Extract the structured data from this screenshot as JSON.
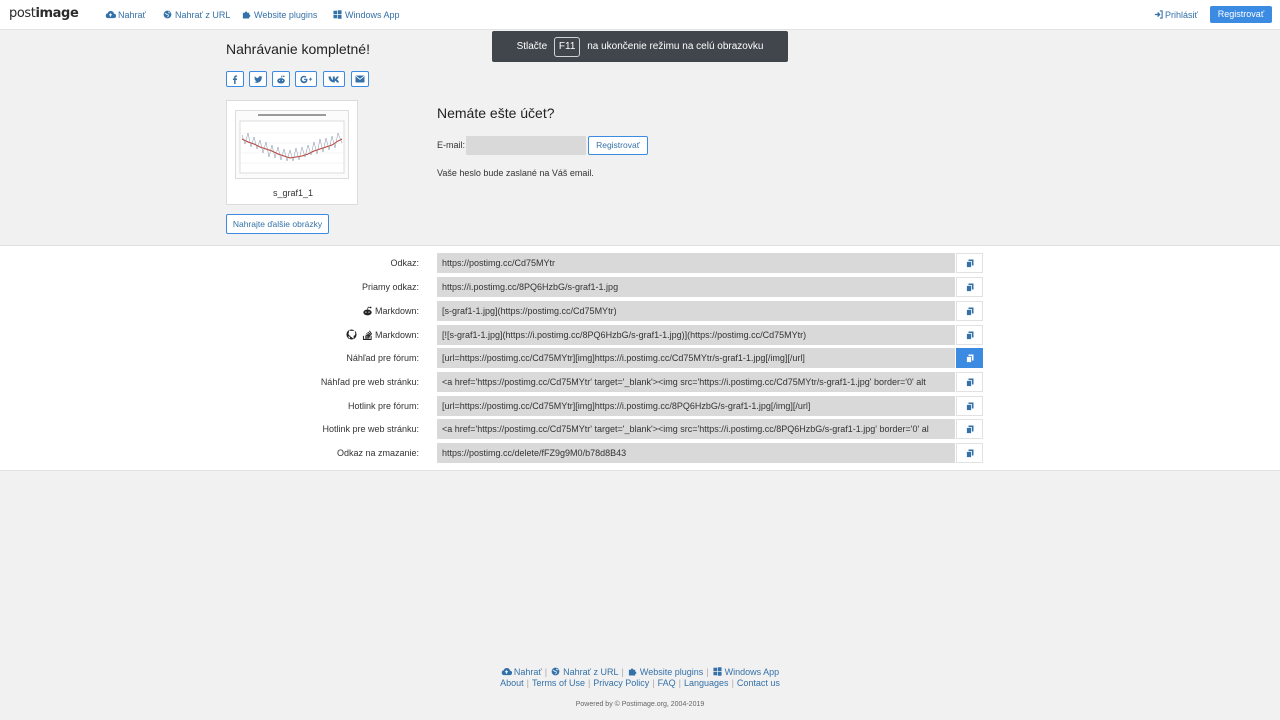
{
  "header": {
    "logo_light": "post",
    "logo_bold": "image",
    "nav": [
      "Nahrať",
      "Nahrať z URL",
      "Website plugins",
      "Windows App"
    ],
    "login": "Prihlásiť",
    "register": "Registrovať"
  },
  "toast": {
    "before": "Stlačte",
    "key": "F11",
    "after": "na ukončenie režimu na celú obrazovku"
  },
  "upload": {
    "title": "Nahrávanie kompletné!",
    "share_icons": [
      "facebook-icon",
      "twitter-icon",
      "reddit-icon",
      "google-plus-icon",
      "vk-icon",
      "email-icon"
    ],
    "image_name": "s_graf1_1",
    "more_button": "Nahrajte ďalšie obrázky"
  },
  "account": {
    "title": "Nemáte ešte účet?",
    "email_label": "E-mail:",
    "email_value": "",
    "register_button": "Registrovať",
    "note": "Vaše heslo bude zaslané na Váš email."
  },
  "links": [
    {
      "label": "Odkaz:",
      "value": "https://postimg.cc/Cd75MYtr"
    },
    {
      "label": "Priamy odkaz:",
      "value": "https://i.postimg.cc/8PQ6HzbG/s-graf1-1.jpg"
    },
    {
      "label": "Markdown:",
      "value": "[s-graf1-1.jpg](https://postimg.cc/Cd75MYtr)"
    },
    {
      "label": "Markdown:",
      "value": "[![s-graf1-1.jpg](https://i.postimg.cc/8PQ6HzbG/s-graf1-1.jpg)](https://postimg.cc/Cd75MYtr)"
    },
    {
      "label": "Náhľad pre fórum:",
      "value": "[url=https://postimg.cc/Cd75MYtr][img]https://i.postimg.cc/Cd75MYtr/s-graf1-1.jpg[/img][/url]"
    },
    {
      "label": "Náhľad pre web stránku:",
      "value": "<a href='https://postimg.cc/Cd75MYtr' target='_blank'><img src='https://i.postimg.cc/Cd75MYtr/s-graf1-1.jpg' border='0' alt"
    },
    {
      "label": "Hotlink pre fórum:",
      "value": "[url=https://postimg.cc/Cd75MYtr][img]https://i.postimg.cc/8PQ6HzbG/s-graf1-1.jpg[/img][/url]"
    },
    {
      "label": "Hotlink pre web stránku:",
      "value": "<a href='https://postimg.cc/Cd75MYtr' target='_blank'><img src='https://i.postimg.cc/8PQ6HzbG/s-graf1-1.jpg' border='0' al"
    },
    {
      "label": "Odkaz na zmazanie:",
      "value": "https://postimg.cc/delete/fFZ9g9M0/b78d8B43"
    }
  ],
  "footer": {
    "nav": [
      "Nahrať",
      "Nahrať z URL",
      "Website plugins",
      "Windows App"
    ],
    "links": [
      "About",
      "Terms of Use",
      "Privacy Policy",
      "FAQ",
      "Languages",
      "Contact us"
    ],
    "powered": "Powered by © Postimage.org, 2004-2019"
  },
  "colors": {
    "accent": "#3c8be3",
    "link": "#3471a8",
    "field_bg": "#d9d9d9",
    "page_bg": "#f1f1f1",
    "toast_bg": "#40464c"
  }
}
